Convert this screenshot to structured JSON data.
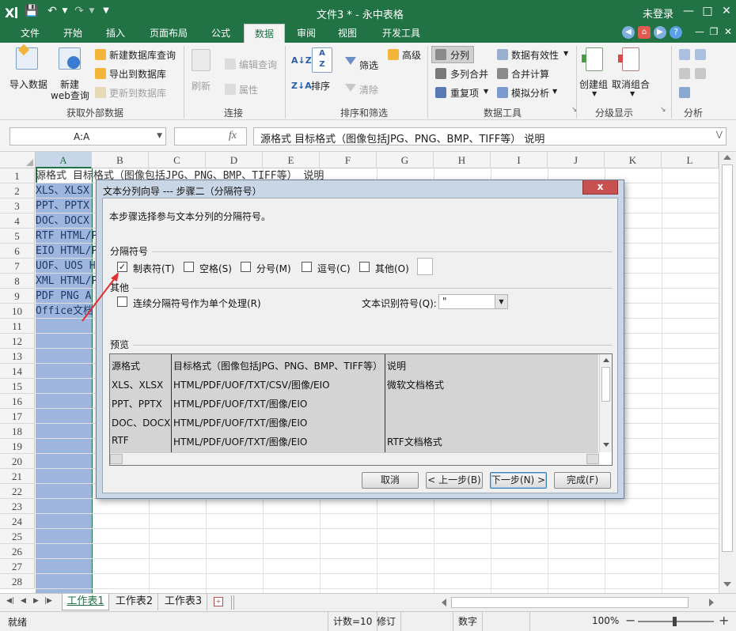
{
  "title": {
    "app_icon": "excel-x-icon",
    "doc_title": "文件3 * - 永中表格",
    "login": "未登录"
  },
  "tabs": [
    "文件",
    "开始",
    "插入",
    "页面布局",
    "公式",
    "数据",
    "审阅",
    "视图",
    "开发工具"
  ],
  "active_tab": "数据",
  "ribbon": {
    "import_data": "导入数据",
    "new_web_query_1": "新建",
    "new_web_query_2": "web查询",
    "new_db_query": "新建数据库查询",
    "export_db": "导出到数据库",
    "refresh_db": "更新到数据库",
    "group_external": "获取外部数据",
    "refresh": "刷新",
    "edit_query": "编辑查询",
    "properties": "属性",
    "group_connection": "连接",
    "sort": "排序",
    "filter": "筛选",
    "clear": "清除",
    "advanced": "高级",
    "group_sort_filter": "排序和筛选",
    "split_col": "分列",
    "merge_cols": "多列合并",
    "duplicates": "重复项",
    "validity": "数据有效性",
    "consolidate": "合并计算",
    "whatif": "模拟分析",
    "group_data_tools": "数据工具",
    "create_group": "创建组",
    "ungroup": "取消组合",
    "group_outline": "分级显示",
    "group_analysis": "分析"
  },
  "formula": {
    "name_box": "A:A",
    "fx": "fx",
    "content": "源格式 目标格式（图像包括JPG、PNG、BMP、TIFF等） 说明"
  },
  "columns": [
    "A",
    "B",
    "C",
    "D",
    "E",
    "F",
    "G",
    "H",
    "I",
    "J",
    "K",
    "L"
  ],
  "rows": [
    "1",
    "2",
    "3",
    "4",
    "5",
    "6",
    "7",
    "8",
    "9",
    "10",
    "11",
    "12",
    "13",
    "14",
    "15",
    "16",
    "17",
    "18",
    "19",
    "20",
    "21",
    "22",
    "23",
    "24",
    "25",
    "26",
    "27",
    "28"
  ],
  "cells": [
    "源格式 目标格式（图像包括JPG、PNG、BMP、TIFF等） 说明",
    "XLS、XLSX",
    "PPT、PPTX",
    "DOC、DOCX",
    "RTF HTML/P",
    "EIO HTML/P",
    "UOF、UOS H",
    "XML HTML/P",
    "PDF PNG A",
    "Office文档"
  ],
  "dialog": {
    "title": "文本分列向导 --- 步骤二（分隔符号）",
    "close": "x",
    "intro": "本步骤选择参与文本分列的分隔符号。",
    "sep_section": "分隔符号",
    "tab": "制表符(T)",
    "space": "空格(S)",
    "semicolon": "分号(M)",
    "comma": "逗号(C)",
    "other": "其他(O)",
    "other_section": "其他",
    "consecutive": "连续分隔符号作为单个处理(R)",
    "qualifier_label": "文本识别符号(Q):",
    "qualifier_value": "\"",
    "preview_section": "预览",
    "preview_rows": [
      [
        "源格式",
        "目标格式（图像包括JPG、PNG、BMP、TIFF等）",
        "说明"
      ],
      [
        "XLS、XLSX",
        "HTML/PDF/UOF/TXT/CSV/图像/EIO",
        "微软文档格式"
      ],
      [
        "PPT、PPTX",
        "HTML/PDF/UOF/TXT/图像/EIO",
        ""
      ],
      [
        "DOC、DOCX",
        "HTML/PDF/UOF/TXT/图像/EIO",
        ""
      ],
      [
        "RTF",
        "HTML/PDF/UOF/TXT/图像/EIO",
        "RTF文档格式"
      ]
    ],
    "cancel": "取消",
    "back": "< 上一步(B)",
    "next": "下一步(N) >",
    "finish": "完成(F)"
  },
  "sheets": [
    "工作表1",
    "工作表2",
    "工作表3"
  ],
  "active_sheet": "工作表1",
  "status": {
    "ready": "就绪",
    "count": "计数=10",
    "revise": "修订",
    "numlock": "数字",
    "zoom": "100%"
  },
  "colors": {
    "brand": "#217346",
    "selection": "#9eb6dd"
  }
}
